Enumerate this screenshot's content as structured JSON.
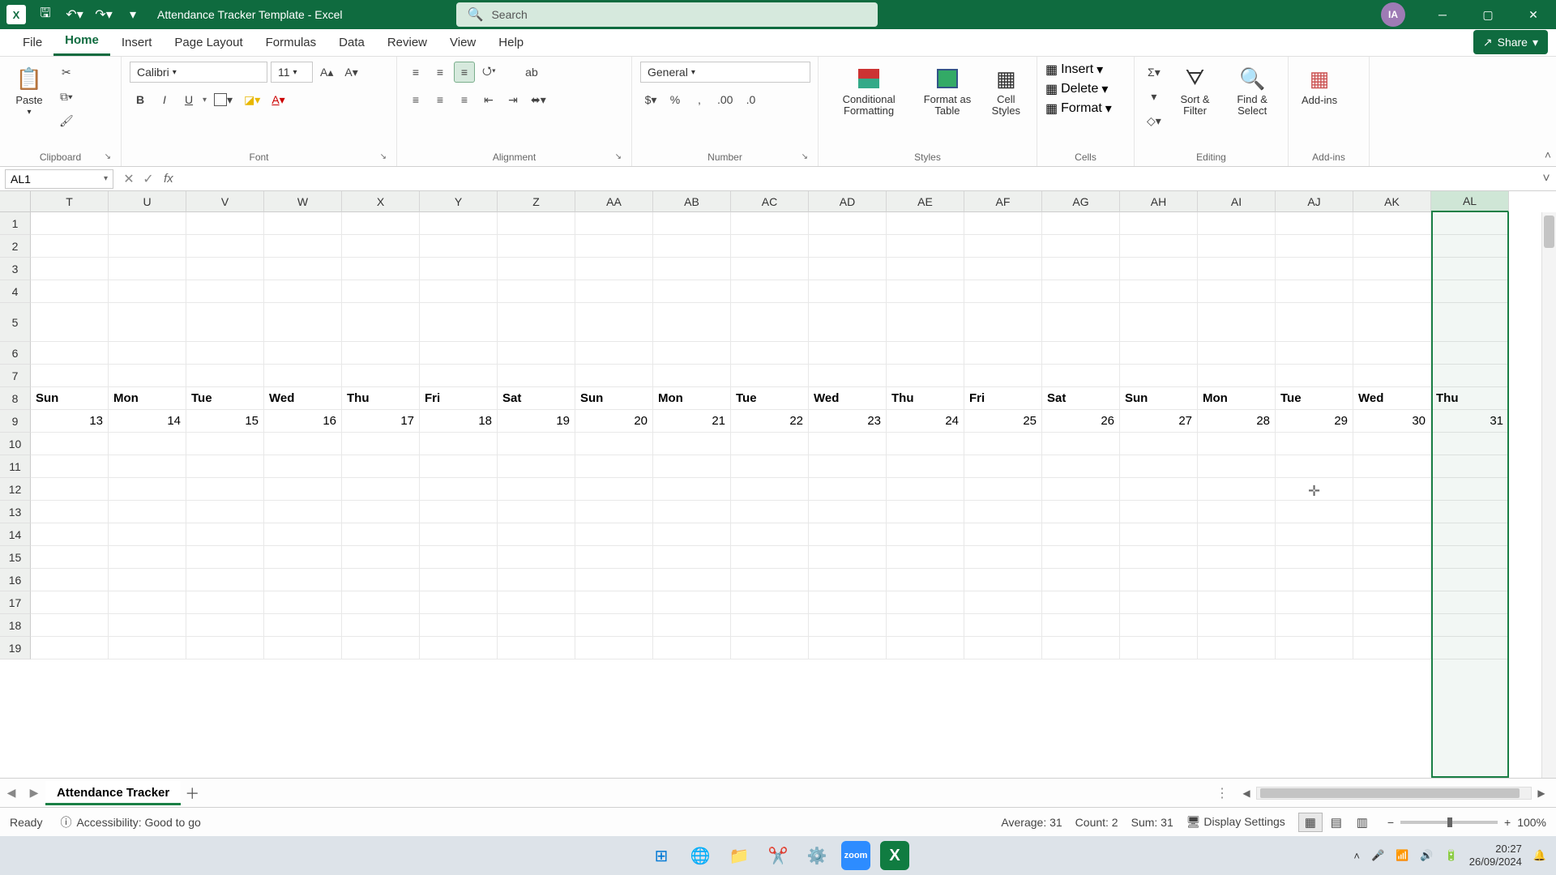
{
  "titlebar": {
    "app_letter": "X",
    "title": "Attendance Tracker Template  -  Excel",
    "search_placeholder": "Search",
    "user_initials": "IA"
  },
  "tabs": {
    "items": [
      "File",
      "Home",
      "Insert",
      "Page Layout",
      "Formulas",
      "Data",
      "Review",
      "View",
      "Help"
    ],
    "active_index": 1,
    "share_label": "Share"
  },
  "ribbon": {
    "clipboard": {
      "paste": "Paste",
      "label": "Clipboard"
    },
    "font": {
      "name": "Calibri",
      "size": "11",
      "bold": "B",
      "italic": "I",
      "underline": "U",
      "label": "Font"
    },
    "alignment": {
      "wrap": "ab",
      "label": "Alignment"
    },
    "number": {
      "format": "General",
      "percent": "%",
      "comma": ",",
      "inc_dec": ".00",
      "dec_dec": ".0",
      "label": "Number"
    },
    "styles": {
      "cond": "Conditional Formatting",
      "fat": "Format as Table",
      "cell": "Cell Styles",
      "label": "Styles"
    },
    "cells": {
      "insert": "Insert",
      "delete": "Delete",
      "format": "Format",
      "label": "Cells"
    },
    "editing": {
      "sort": "Sort & Filter",
      "find": "Find & Select",
      "label": "Editing"
    },
    "addins": {
      "big": "Add-ins",
      "label": "Add-ins"
    }
  },
  "fbar": {
    "name": "AL1",
    "value": ""
  },
  "grid": {
    "columns": [
      "T",
      "U",
      "V",
      "W",
      "X",
      "Y",
      "Z",
      "AA",
      "AB",
      "AC",
      "AD",
      "AE",
      "AF",
      "AG",
      "AH",
      "AI",
      "AJ",
      "AK",
      "AL"
    ],
    "selected_col_index": 18,
    "row_heights_special": {
      "5": 48
    },
    "row_count": 19,
    "days_row": [
      "Sun",
      "Mon",
      "Tue",
      "Wed",
      "Thu",
      "Fri",
      "Sat",
      "Sun",
      "Mon",
      "Tue",
      "Wed",
      "Thu",
      "Fri",
      "Sat",
      "Sun",
      "Mon",
      "Tue",
      "Wed",
      "Thu"
    ],
    "nums_row": [
      "13",
      "14",
      "15",
      "16",
      "17",
      "18",
      "19",
      "20",
      "21",
      "22",
      "23",
      "24",
      "25",
      "26",
      "27",
      "28",
      "29",
      "30",
      "31"
    ],
    "cursor_pos": {
      "col": 16,
      "row": 12
    }
  },
  "sheettabs": {
    "sheets": [
      "Attendance Tracker"
    ],
    "active_index": 0
  },
  "status": {
    "ready": "Ready",
    "accessibility": "Accessibility: Good to go",
    "average": "Average: 31",
    "count": "Count: 2",
    "sum": "Sum: 31",
    "display": "Display Settings",
    "zoom": "100%"
  },
  "taskbar": {
    "time": "20:27",
    "date": "26/09/2024"
  }
}
